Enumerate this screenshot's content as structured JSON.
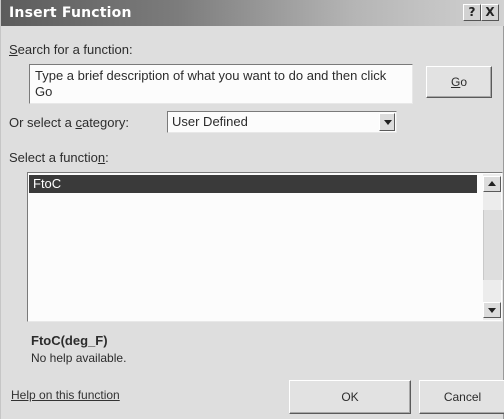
{
  "dialog": {
    "title": "Insert Function",
    "help_button": "?",
    "close_button": "X"
  },
  "search": {
    "label_prefix": "",
    "label_key": "S",
    "label_rest": "earch for a function:",
    "value": "Type a brief description of what you want to do and then click Go",
    "go_label_key": "G",
    "go_label_rest": "o"
  },
  "category": {
    "label_before": "Or select a ",
    "label_key": "c",
    "label_after": "ategory:",
    "selected": "User Defined"
  },
  "functions": {
    "label_before": "Select a functio",
    "label_key": "n",
    "label_after": ":",
    "items": [
      "FtoC"
    ],
    "selected_index": 0
  },
  "details": {
    "signature": "FtoC(deg_F)",
    "description": "No help available."
  },
  "footer": {
    "help_link": "Help on this function",
    "ok_label": "OK",
    "cancel_label": "Cancel"
  }
}
